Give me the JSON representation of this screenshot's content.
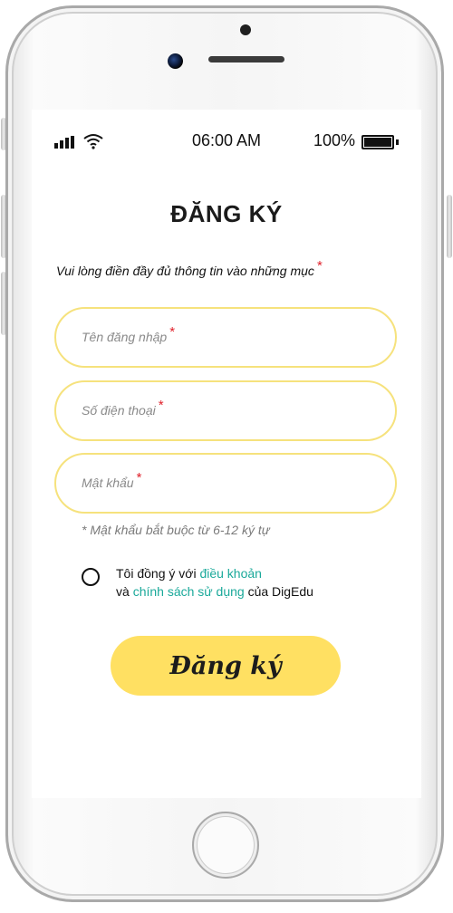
{
  "status_bar": {
    "time": "06:00 AM",
    "battery": "100%",
    "battery_level": 1.0
  },
  "form": {
    "title": "ĐĂNG KÝ",
    "instruction": "Vui lòng điền đầy đủ thông tin vào những mục",
    "required_mark": "*",
    "fields": [
      {
        "placeholder": "Tên đăng nhập",
        "value": "",
        "required_mark": "*"
      },
      {
        "placeholder": "Số điện thoại",
        "value": "",
        "required_mark": "*"
      },
      {
        "placeholder": "Mật khẩu",
        "value": "",
        "required_mark": "*"
      }
    ],
    "password_hint": "* Mật khẩu bắt buộc từ 6-12 ký tự",
    "terms": {
      "checked": false,
      "line1_prefix": "Tôi đồng ý với ",
      "terms_link": "điều khoản",
      "line2_prefix": "và ",
      "policy_link": "chính sách sử dụng",
      "line2_suffix": " của DigEdu"
    },
    "submit_label": "Đăng ký"
  },
  "colors": {
    "field_border": "#f6e27d",
    "button": "#ffe062",
    "link": "#1aa99a",
    "required": "#e0212b"
  },
  "icons": {
    "signal": "signal-bars-icon",
    "wifi": "wifi-icon",
    "battery": "battery-icon"
  }
}
